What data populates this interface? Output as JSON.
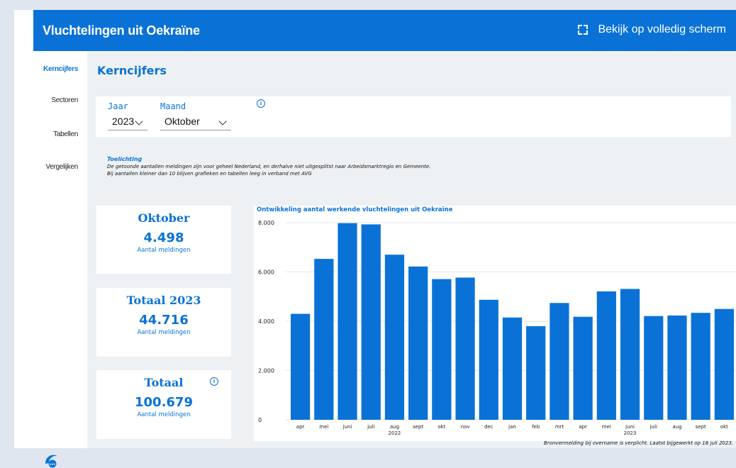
{
  "header": {
    "title": "Vluchtelingen uit Oekraïne",
    "fullscreen_label": "Bekijk op volledig scherm"
  },
  "sidebar": {
    "items": [
      {
        "label": "Kerncijfers",
        "active": true
      },
      {
        "label": "Sectoren",
        "active": false
      },
      {
        "label": "Tabellen",
        "active": false
      },
      {
        "label": "Vergelijken",
        "active": false
      }
    ],
    "logo_text": "uwv"
  },
  "main": {
    "title": "Kerncijfers",
    "filters": {
      "year_label": "Jaar",
      "year_value": "2023",
      "month_label": "Maand",
      "month_value": "Oktober"
    },
    "note": {
      "heading": "Toelichting",
      "line1": "De getoonde aantallen meldingen zijn voor geheel Nederland, en derhalve niet uitgesplitst naar Arbeidsmarktregio en Gemeente.",
      "line2": "Bij aantallen kleiner dan 10 blijven grafieken en tabellen leeg in verband met AVG"
    },
    "cards": [
      {
        "title": "Oktober",
        "value": "4.498",
        "label": "Aantal meldingen"
      },
      {
        "title": "Totaal 2023",
        "value": "44.716",
        "label": "Aantal meldingen"
      },
      {
        "title": "Totaal",
        "value": "100.679",
        "label": "Aantal meldingen"
      }
    ],
    "source_note": "Bronvermelding bij overname is verplicht. Laatst bijgewerkt op 18 juli 2023."
  },
  "colors": {
    "accent": "#0a72d6",
    "bar": "#0a72d6"
  },
  "chart_data": {
    "type": "bar",
    "title": "Ontwikkeling aantal werkende vluchtelingen uit Oekraïne",
    "categories": [
      "apr",
      "mei",
      "juni",
      "juli",
      "aug",
      "sept",
      "okt",
      "nov",
      "dec",
      "jan",
      "feb",
      "mrt",
      "apr",
      "mei",
      "juni",
      "juli",
      "aug",
      "sept",
      "okt"
    ],
    "year_labels": [
      {
        "index": 4,
        "label": "2022"
      },
      {
        "index": 14,
        "label": "2023"
      }
    ],
    "values": [
      4300,
      6530,
      7980,
      7930,
      6700,
      6220,
      5710,
      5770,
      4870,
      4150,
      3800,
      4740,
      4180,
      5210,
      5310,
      4210,
      4230,
      4340,
      4498
    ],
    "ylim": [
      0,
      8000
    ],
    "yticks": [
      0,
      2000,
      4000,
      6000,
      8000
    ],
    "ytick_labels": [
      "0",
      "2.000",
      "4.000",
      "6.000",
      "8.000"
    ],
    "grid": true
  }
}
